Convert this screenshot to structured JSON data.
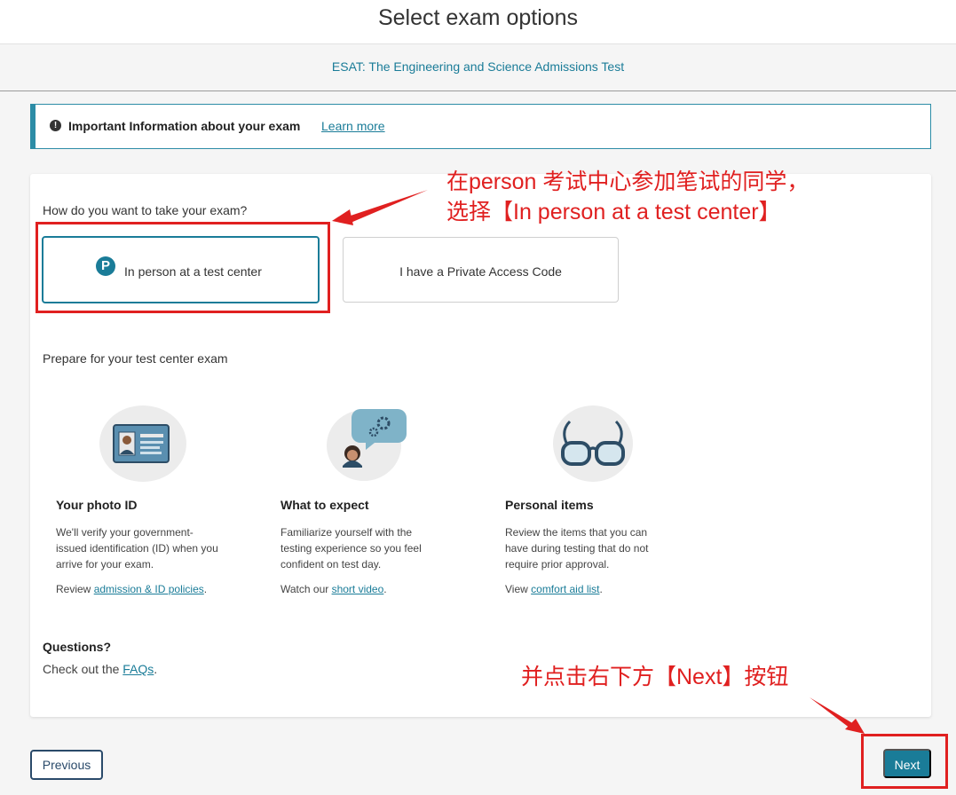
{
  "header": {
    "title": "Select exam options"
  },
  "exam": {
    "name": "ESAT: The Engineering and Science Admissions Test"
  },
  "banner": {
    "text": "Important Information about your exam",
    "link": "Learn more"
  },
  "delivery": {
    "question": "How do you want to take your exam?",
    "options": [
      {
        "label": "In person at a test center",
        "selected": true
      },
      {
        "label": "I have a Private Access Code",
        "selected": false
      }
    ]
  },
  "prepare": {
    "heading": "Prepare for your test center exam",
    "items": [
      {
        "icon": "photo-id-card-icon",
        "title": "Your photo ID",
        "body": [
          "We'll verify your government-",
          "issued identification (ID) when you",
          "arrive for your exam."
        ],
        "link_prefix": "Review ",
        "link_text": "admission & ID policies",
        "link_suffix": "."
      },
      {
        "icon": "person-speech-gears-icon",
        "title": "What to expect",
        "body": [
          "Familiarize yourself with the",
          "testing experience so you feel",
          "confident on test day."
        ],
        "link_prefix": "Watch our ",
        "link_text": "short video",
        "link_suffix": "."
      },
      {
        "icon": "eyeglasses-icon",
        "title": "Personal items",
        "body": [
          "Review the items that you can",
          "have during testing that do not",
          "require prior approval."
        ],
        "link_prefix": "View ",
        "link_text": "comfort aid list",
        "link_suffix": "."
      }
    ]
  },
  "questions": {
    "title": "Questions?",
    "prefix": "Check out the ",
    "link": "FAQs",
    "suffix": "."
  },
  "footer": {
    "previous": "Previous",
    "next": "Next"
  },
  "annotations": {
    "line1": "在person 考试中心参加笔试的同学，",
    "line2": "选择【In person at a test center】",
    "line3": "并点击右下方【Next】按钮"
  },
  "colors": {
    "accent": "#1a7c98",
    "annotation": "#e02020",
    "button_border": "#2a4a6a"
  }
}
